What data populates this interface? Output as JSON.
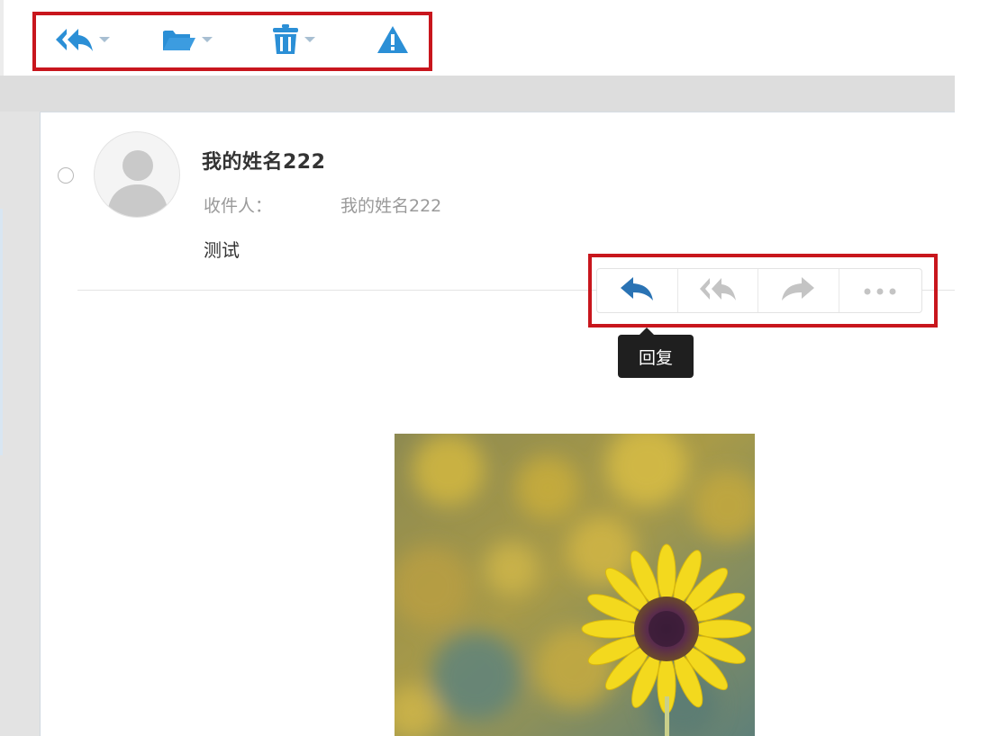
{
  "toolbar": {
    "buttons": [
      {
        "icon": "reply-all-icon",
        "has_dropdown": true
      },
      {
        "icon": "folder-icon",
        "has_dropdown": true
      },
      {
        "icon": "trash-icon",
        "has_dropdown": true
      },
      {
        "icon": "warning-icon",
        "has_dropdown": false
      }
    ]
  },
  "message": {
    "sender_name": "我的姓名222",
    "to_label": "收件人：",
    "to_value": "我的姓名222",
    "subject": "测试"
  },
  "actions": [
    {
      "icon": "reply-icon",
      "active": true
    },
    {
      "icon": "reply-all-icon",
      "active": false
    },
    {
      "icon": "forward-icon",
      "active": false
    },
    {
      "icon": "more-icon",
      "active": false
    }
  ],
  "tooltip": {
    "text": "回复"
  },
  "attachment_image": {
    "subject": "sunflower"
  },
  "colors": {
    "accent_blue": "#2b8fd6",
    "active_icon": "#2a73b4",
    "inactive_icon": "#c4c4c4",
    "highlight_red": "#c8161d",
    "tooltip_bg": "#1f1f1f"
  }
}
